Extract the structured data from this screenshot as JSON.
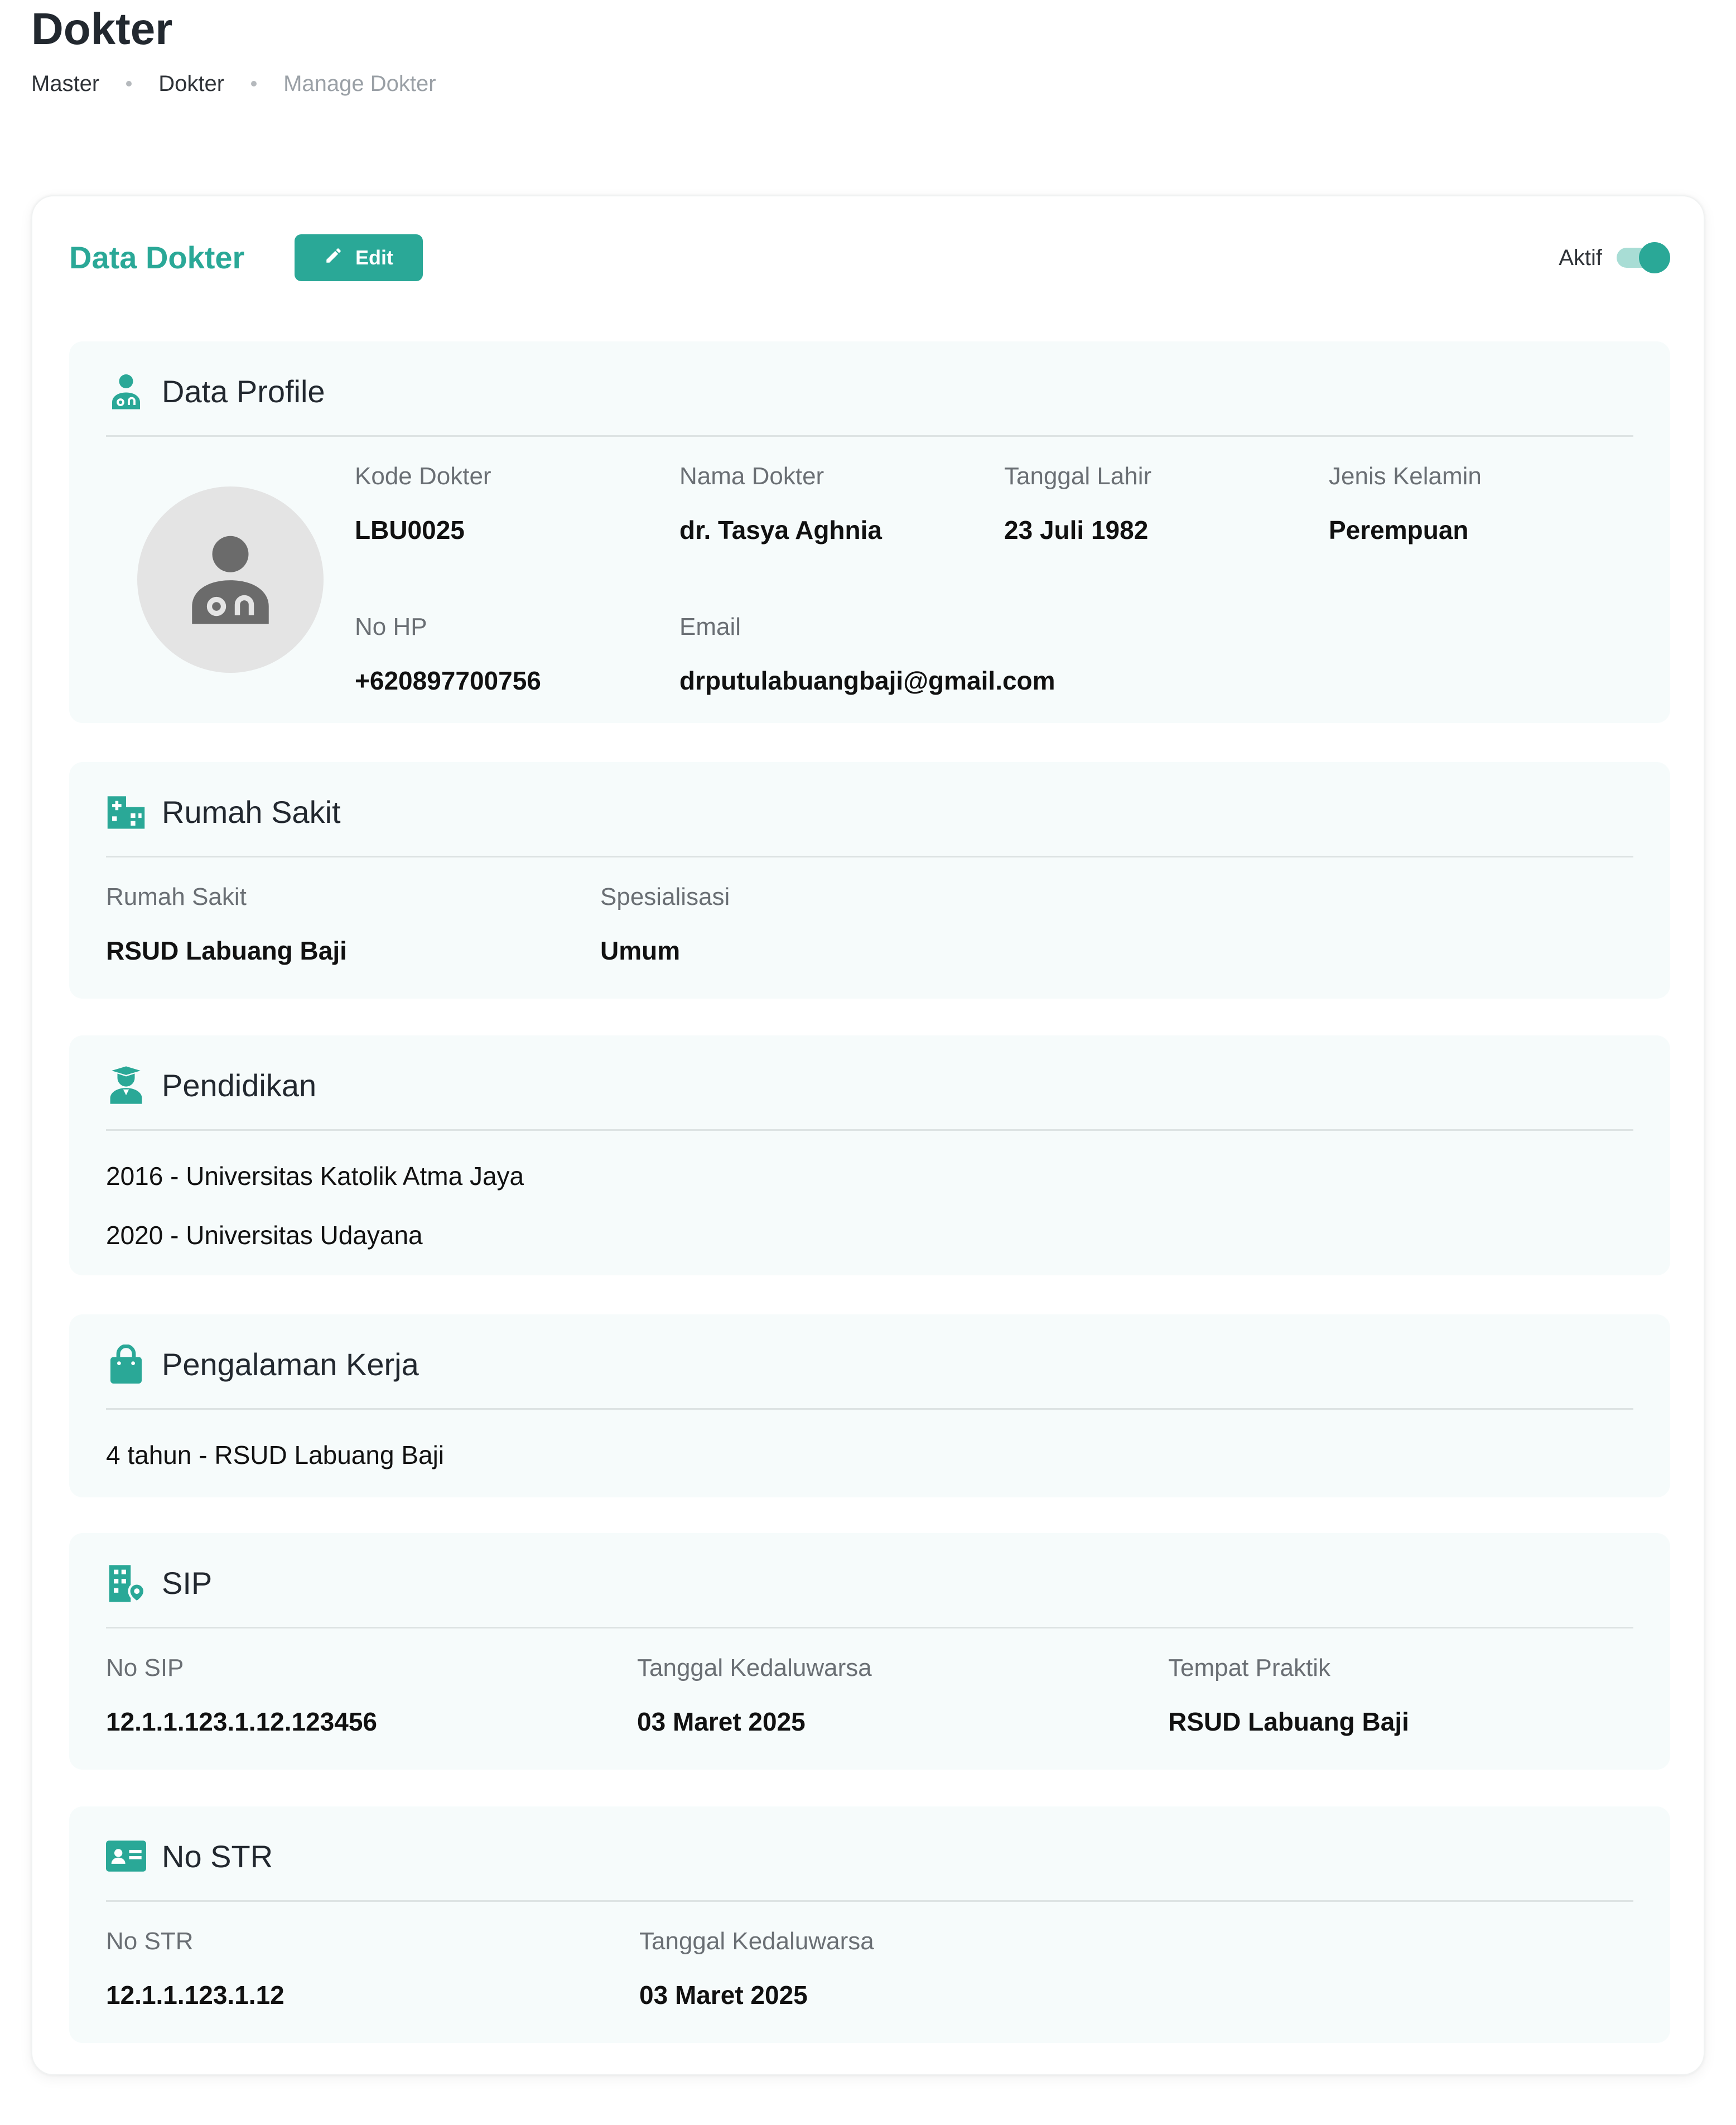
{
  "page": {
    "title": "Dokter",
    "breadcrumb": [
      "Master",
      "Dokter",
      "Manage Dokter"
    ]
  },
  "card": {
    "title": "Data Dokter",
    "edit_label": "Edit",
    "status_label": "Aktif",
    "status_on": true
  },
  "colors": {
    "accent": "#2aa897",
    "section_bg": "#f6fbfb",
    "toggle_track": "#a8ddd5"
  },
  "profile": {
    "title": "Data Profile",
    "icon": "doctor-icon",
    "avatar_icon": "doctor-avatar-icon",
    "fields": {
      "kode": {
        "label": "Kode Dokter",
        "value": "LBU0025"
      },
      "nama": {
        "label": "Nama Dokter",
        "value": "dr. Tasya Aghnia"
      },
      "lahir": {
        "label": "Tanggal Lahir",
        "value": "23 Juli 1982"
      },
      "kelamin": {
        "label": "Jenis Kelamin",
        "value": "Perempuan"
      },
      "hp": {
        "label": "No HP",
        "value": "+620897700756"
      },
      "email": {
        "label": "Email",
        "value": "drputulabuangbaji@gmail.com"
      }
    }
  },
  "rumah_sakit": {
    "title": "Rumah Sakit",
    "icon": "hospital-icon",
    "fields": {
      "rs": {
        "label": "Rumah Sakit",
        "value": "RSUD Labuang Baji"
      },
      "spesialisasi": {
        "label": "Spesialisasi",
        "value": "Umum"
      }
    }
  },
  "pendidikan": {
    "title": "Pendidikan",
    "icon": "graduate-icon",
    "items": [
      "2016 - Universitas Katolik Atma Jaya",
      "2020 - Universitas Udayana"
    ]
  },
  "pengalaman": {
    "title": "Pengalaman Kerja",
    "icon": "briefcase-icon",
    "items": [
      "4 tahun - RSUD Labuang Baji"
    ]
  },
  "sip": {
    "title": "SIP",
    "icon": "building-location-icon",
    "fields": {
      "no": {
        "label": "No SIP",
        "value": "12.1.1.123.1.12.123456"
      },
      "exp": {
        "label": "Tanggal Kedaluwarsa",
        "value": "03 Maret 2025"
      },
      "tempat": {
        "label": "Tempat Praktik",
        "value": "RSUD Labuang Baji"
      }
    }
  },
  "str": {
    "title": "No STR",
    "icon": "id-card-icon",
    "fields": {
      "no": {
        "label": "No STR",
        "value": "12.1.1.123.1.12"
      },
      "exp": {
        "label": "Tanggal Kedaluwarsa",
        "value": "03 Maret 2025"
      }
    }
  }
}
